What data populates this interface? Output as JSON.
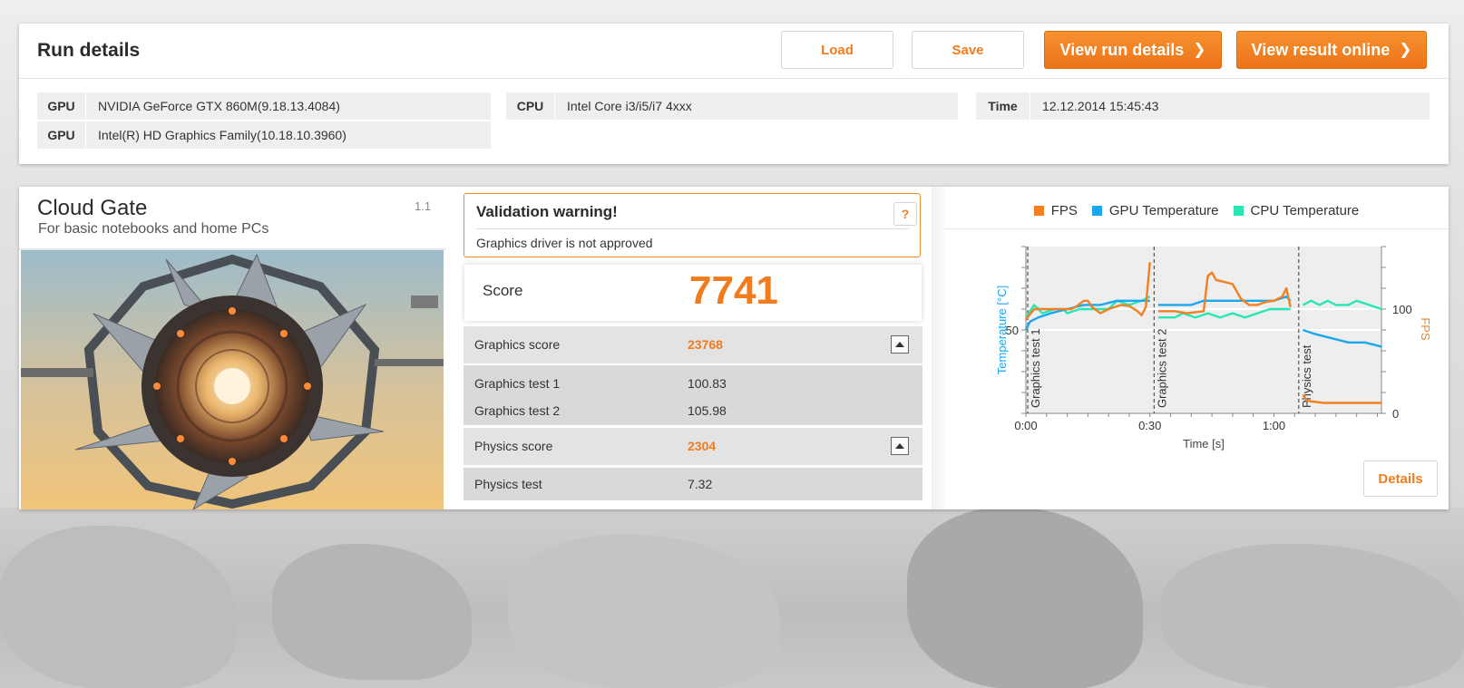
{
  "run_details": {
    "title": "Run details",
    "load_label": "Load",
    "save_label": "Save",
    "view_run_label": "View run details",
    "view_online_label": "View result online",
    "chevron": "❯",
    "gpu_label": "GPU",
    "gpu1": "NVIDIA GeForce GTX 860M(9.18.13.4084)",
    "gpu2": "Intel(R) HD Graphics Family(10.18.10.3960)",
    "cpu_label": "CPU",
    "cpu": "Intel Core i3/i5/i7 4xxx",
    "time_label": "Time",
    "time": "12.12.2014 15:45:43"
  },
  "test": {
    "name": "Cloud Gate",
    "subtitle": "For basic notebooks and home PCs",
    "version": "1.1"
  },
  "validation": {
    "title": "Validation warning!",
    "message": "Graphics driver is not approved",
    "help": "?"
  },
  "score": {
    "label": "Score",
    "value": "7741"
  },
  "graphics": {
    "label": "Graphics score",
    "value": "23768",
    "test1_label": "Graphics test 1",
    "test1_value": "100.83",
    "test2_label": "Graphics test 2",
    "test2_value": "105.98"
  },
  "physics": {
    "label": "Physics score",
    "value": "2304",
    "test_label": "Physics test",
    "test_value": "7.32"
  },
  "details_label": "Details",
  "colors": {
    "accent": "#f07c1e",
    "fps": "#f28021",
    "gpu_temp": "#1aa7ee",
    "cpu_temp": "#27e8b5"
  },
  "chart_data": {
    "type": "line",
    "legend": [
      "FPS",
      "GPU Temperature",
      "CPU Temperature"
    ],
    "legend_position": "top",
    "xlabel": "Time [s]",
    "ylabel_left": "Temperature [°C]",
    "ylabel_right": "FPS",
    "x_ticks": [
      "0:00",
      "0:30",
      "1:00"
    ],
    "y_left_ticks": [
      "50"
    ],
    "y_right_ticks": [
      "100",
      "0"
    ],
    "x_range": [
      0,
      86
    ],
    "temp_range": [
      30,
      70
    ],
    "fps_range": [
      0,
      160
    ],
    "section_labels": [
      {
        "label": "Graphics test 1",
        "x": 0
      },
      {
        "label": "Graphics test 2",
        "x": 31
      },
      {
        "label": "Physics test",
        "x": 66
      }
    ],
    "series": [
      {
        "name": "FPS",
        "points": [
          [
            0,
            90
          ],
          [
            2,
            100
          ],
          [
            4,
            100
          ],
          [
            7,
            100
          ],
          [
            11,
            100
          ],
          [
            12,
            102
          ],
          [
            14,
            108
          ],
          [
            15,
            108
          ],
          [
            16,
            102
          ],
          [
            18,
            96
          ],
          [
            20,
            100
          ],
          [
            23,
            104
          ],
          [
            25,
            103
          ],
          [
            27,
            98
          ],
          [
            28,
            94
          ],
          [
            29,
            102
          ],
          [
            30,
            145
          ],
          [
            32,
            98
          ],
          [
            36,
            98
          ],
          [
            39,
            96
          ],
          [
            43,
            98
          ],
          [
            44,
            132
          ],
          [
            45,
            135
          ],
          [
            46,
            128
          ],
          [
            48,
            126
          ],
          [
            50,
            124
          ],
          [
            52,
            110
          ],
          [
            54,
            104
          ],
          [
            56,
            104
          ],
          [
            58,
            107
          ],
          [
            60,
            108
          ],
          [
            62,
            112
          ],
          [
            63,
            120
          ],
          [
            64,
            102
          ],
          [
            67,
            18
          ],
          [
            68,
            12
          ],
          [
            72,
            10
          ],
          [
            80,
            10
          ],
          [
            86,
            10
          ]
        ]
      },
      {
        "name": "GPU Temperature",
        "points": [
          [
            0,
            50
          ],
          [
            1,
            52
          ],
          [
            3,
            53
          ],
          [
            6,
            54
          ],
          [
            10,
            55
          ],
          [
            14,
            56
          ],
          [
            18,
            56
          ],
          [
            22,
            57
          ],
          [
            26,
            57
          ],
          [
            30,
            57
          ],
          [
            32,
            56
          ],
          [
            36,
            56
          ],
          [
            40,
            56
          ],
          [
            43,
            57
          ],
          [
            46,
            57
          ],
          [
            50,
            57
          ],
          [
            55,
            57
          ],
          [
            60,
            57
          ],
          [
            63,
            58
          ],
          [
            64,
            57
          ],
          [
            67,
            50
          ],
          [
            70,
            49
          ],
          [
            74,
            48
          ],
          [
            78,
            47
          ],
          [
            82,
            47
          ],
          [
            86,
            46
          ]
        ]
      },
      {
        "name": "CPU Temperature",
        "points": [
          [
            0,
            53
          ],
          [
            2,
            56
          ],
          [
            4,
            54
          ],
          [
            7,
            55
          ],
          [
            9,
            55
          ],
          [
            10,
            54
          ],
          [
            13,
            55
          ],
          [
            16,
            55
          ],
          [
            20,
            55
          ],
          [
            22,
            57
          ],
          [
            25,
            56
          ],
          [
            28,
            57
          ],
          [
            30,
            58
          ],
          [
            32,
            53
          ],
          [
            36,
            53
          ],
          [
            38,
            54
          ],
          [
            41,
            53
          ],
          [
            44,
            54
          ],
          [
            47,
            53
          ],
          [
            50,
            54
          ],
          [
            53,
            53
          ],
          [
            56,
            54
          ],
          [
            59,
            55
          ],
          [
            62,
            55
          ],
          [
            64,
            55
          ],
          [
            67,
            56
          ],
          [
            69,
            57
          ],
          [
            71,
            56
          ],
          [
            73,
            57
          ],
          [
            75,
            56
          ],
          [
            78,
            56
          ],
          [
            80,
            57
          ],
          [
            83,
            56
          ],
          [
            86,
            55
          ]
        ]
      }
    ]
  }
}
